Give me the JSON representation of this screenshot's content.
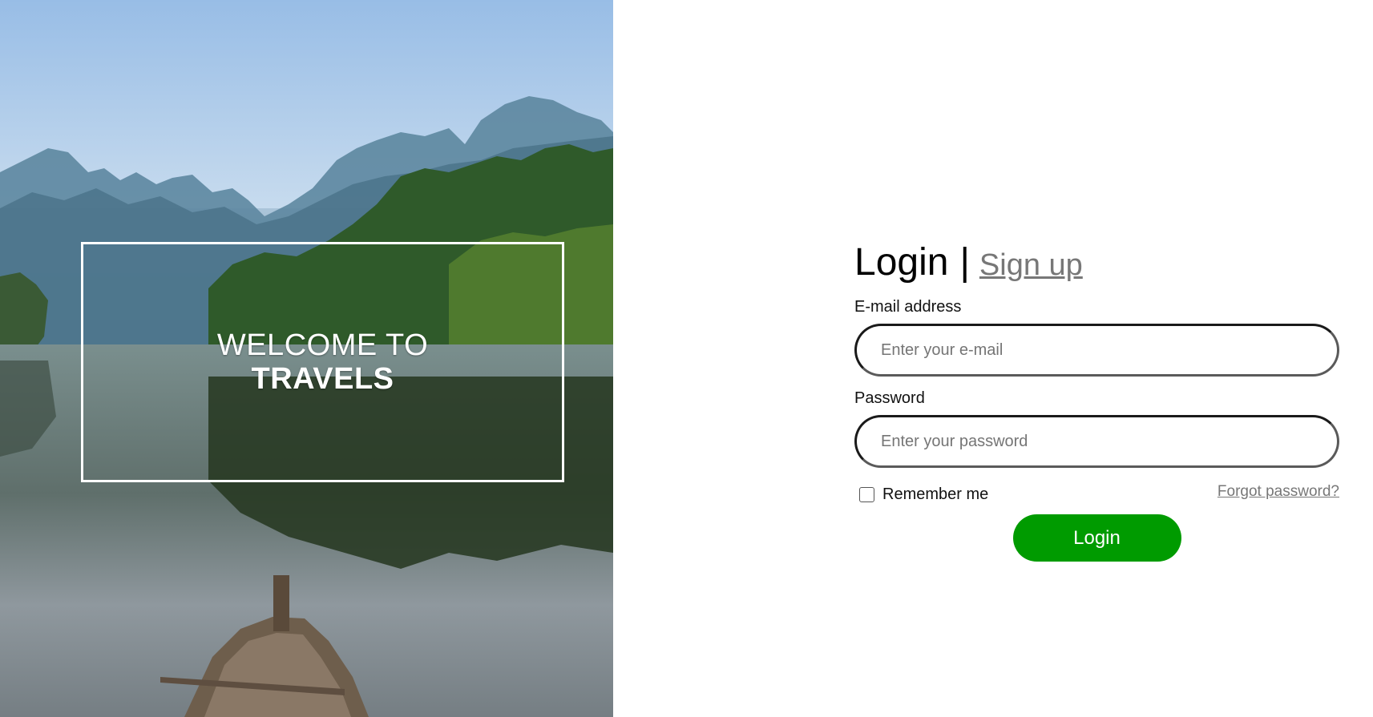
{
  "hero": {
    "welcome_line1": "WELCOME TO",
    "welcome_line2": "TRAVELS"
  },
  "form": {
    "heading_login": "Login",
    "heading_separator": "|",
    "heading_signup": "Sign up",
    "email_label": "E-mail address",
    "email_placeholder": "Enter your e-mail",
    "password_label": "Password",
    "password_placeholder": "Enter your password",
    "remember_label": "Remember me",
    "remember_checked": false,
    "forgot_label": "Forgot password?",
    "login_button": "Login"
  },
  "colors": {
    "login_button_bg": "#009b00",
    "link": "#777777",
    "text": "#000000"
  }
}
